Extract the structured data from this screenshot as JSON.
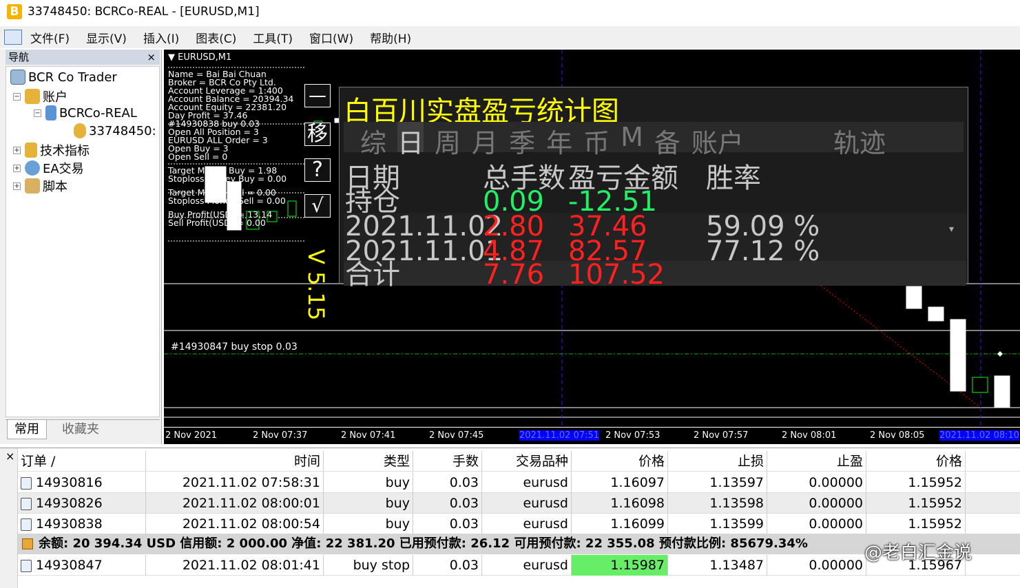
{
  "window": {
    "title": "33748450: BCRCo-REAL - [EURUSD,M1]"
  },
  "menu": [
    "文件(F)",
    "显示(V)",
    "插入(I)",
    "图表(C)",
    "工具(T)",
    "窗口(W)",
    "帮助(H)"
  ],
  "navigator": {
    "title": "导航",
    "close": "×",
    "items": [
      {
        "label": "BCR Co Trader",
        "expander": "",
        "icon": "terminal-icon"
      },
      {
        "label": "账户",
        "expander": "−",
        "icon": "accounts-icon"
      },
      {
        "label": "BCRCo-REAL",
        "expander": "−",
        "icon": "server-icon"
      },
      {
        "label": "33748450:",
        "expander": "",
        "icon": "user-icon"
      },
      {
        "label": "技术指标",
        "expander": "+",
        "icon": "indicator-icon"
      },
      {
        "label": "EA交易",
        "expander": "+",
        "icon": "expert-icon"
      },
      {
        "label": "脚本",
        "expander": "+",
        "icon": "script-icon"
      }
    ],
    "tabs": [
      "常用",
      "收藏夹"
    ]
  },
  "chart": {
    "symbol": "EURUSD,M1",
    "info_lines": [
      "Name = Bai Bai Chuan",
      "Broker = BCR Co Pty Ltd.",
      "Account Leverage = 1:400",
      "Account Balance = 20394.34",
      "Account Equity = 22381.20",
      "Day Profit = 37.46",
      "#14930838 buy 0.03",
      "Open All Position = 3",
      "EURUSD ALL Order = 3",
      "Open Buy  = 3",
      "Open Sell = 0",
      "Target Money Buy = 1.98",
      "Stoploss Money Buy = 0.00",
      "Target Money Sell = 0.00",
      "Stoploss Money Sell = 0.00",
      "Buy Profit(USD) = 13.14",
      "Sell Profit(USD) = 0.00"
    ],
    "side_buttons": [
      "—",
      "移",
      "?",
      "√"
    ],
    "version": "V 5.15",
    "pending_order_label": "#14930847 buy stop 0.03",
    "time_ticks": [
      "2 Nov 2021",
      "2 Nov 07:37",
      "2 Nov 07:41",
      "2 Nov 07:45",
      "2021.11.02 07:51",
      "2 Nov 07:53",
      "2 Nov 07:57",
      "2 Nov 08:01",
      "2 Nov 08:05",
      "2021.11.02 08:10"
    ],
    "colors": {
      "background": "#000000",
      "bull": "#00ff00",
      "bear": "#ffffff",
      "pending_line": "#00c000",
      "trend_line": "#ff0000",
      "highlight": "#0000ff"
    }
  },
  "stats": {
    "title": "白百川实盘盈亏统计图",
    "tabs": [
      "综",
      "日",
      "周",
      "月",
      "季",
      "年",
      "币",
      "M",
      "备",
      "账户",
      "轨迹"
    ],
    "active_tab": "日",
    "headers": [
      "日期",
      "总手数",
      "盈亏金额",
      "胜率"
    ],
    "holding": {
      "label": "持仓",
      "lots": "0.09",
      "profit": "-12.51"
    },
    "rows": [
      {
        "date": "2021.11.02",
        "lots": "2.80",
        "profit": "37.46",
        "winrate": "59.09 %"
      },
      {
        "date": "2021.11.01",
        "lots": "4.87",
        "profit": "82.57",
        "winrate": "77.12 %"
      }
    ],
    "total": {
      "label": "合计",
      "lots": "7.76",
      "profit": "107.52"
    },
    "dropdown": "▾",
    "colors": {
      "title": "#ffff00",
      "positive": "#ff2020",
      "holding": "#22ee66",
      "neutral": "#c8c8c8"
    }
  },
  "terminal": {
    "close": "×",
    "headers": [
      "订单 /",
      "时间",
      "类型",
      "手数",
      "交易品种",
      "价格",
      "止损",
      "止盈",
      "价格"
    ],
    "orders": [
      {
        "id": "14930816",
        "time": "2021.11.02 07:58:31",
        "type": "buy",
        "lots": "0.03",
        "symbol": "eurusd",
        "price": "1.16097",
        "sl": "1.13597",
        "tp": "0.00000",
        "current": "1.15952"
      },
      {
        "id": "14930826",
        "time": "2021.11.02 08:00:01",
        "type": "buy",
        "lots": "0.03",
        "symbol": "eurusd",
        "price": "1.16098",
        "sl": "1.13598",
        "tp": "0.00000",
        "current": "1.15952"
      },
      {
        "id": "14930838",
        "time": "2021.11.02 08:00:54",
        "type": "buy",
        "lots": "0.03",
        "symbol": "eurusd",
        "price": "1.16099",
        "sl": "1.13599",
        "tp": "0.00000",
        "current": "1.15952"
      }
    ],
    "balance_line": "余额: 20 394.34 USD  信用额: 2 000.00  净值: 22 381.20  已用预付款: 26.12  可用预付款: 22 355.08  预付款比例: 85679.34%",
    "pending": {
      "id": "14930847",
      "time": "2021.11.02 08:01:41",
      "type": "buy stop",
      "lots": "0.03",
      "symbol": "eurusd",
      "price": "1.15987",
      "sl": "1.13487",
      "tp": "0.00000",
      "current": "1.15967"
    },
    "watermark": "@老白汇金说"
  }
}
